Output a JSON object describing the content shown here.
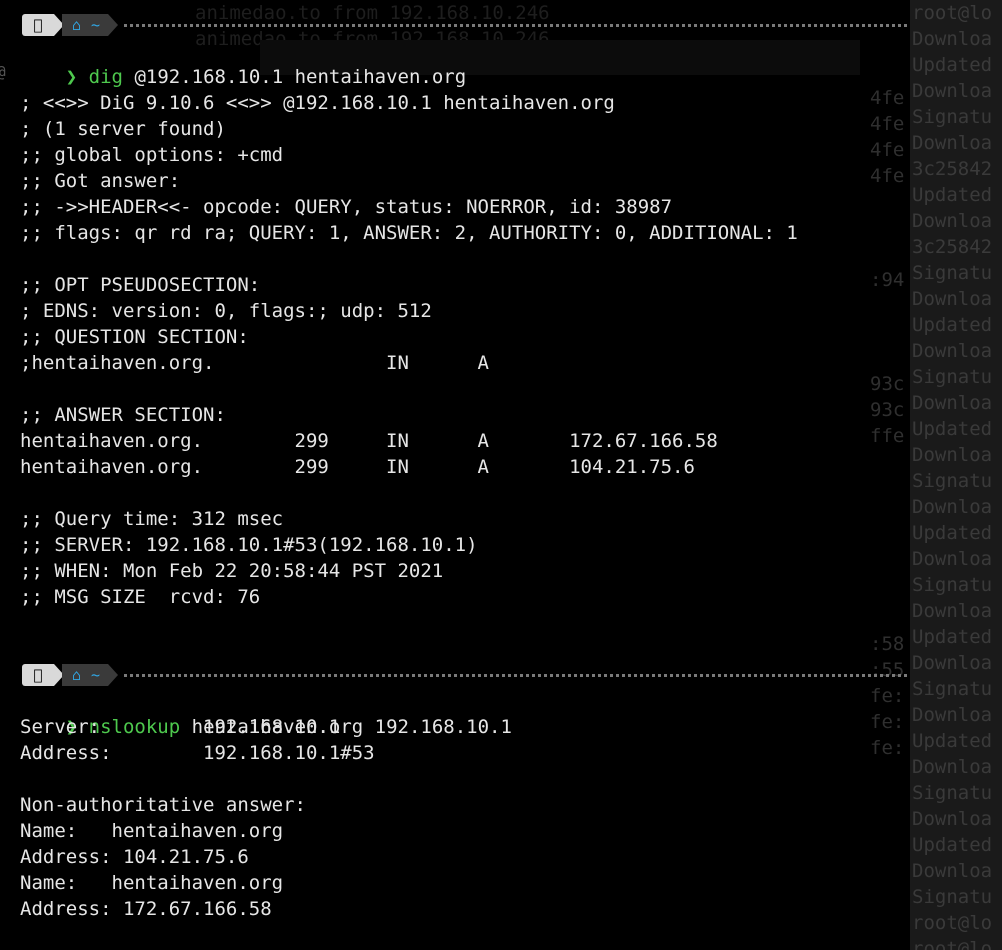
{
  "background": {
    "side_lines": [
      "root@lo",
      "Downloa",
      "Updated",
      "Downloa",
      "Signatu",
      "Downloa",
      "3c25842",
      "Updated",
      "Downloa",
      "3c25842",
      "Signatu",
      "Downloa",
      "Updated",
      "Downloa",
      "Signatu",
      "Downloa",
      "Updated",
      "Downloa",
      "Signatu",
      "Downloa",
      "Updated",
      "Downloa",
      "Signatu",
      "Downloa",
      "Updated",
      "Downloa",
      "Signatu",
      "Downloa",
      "Updated",
      "Downloa",
      "Signatu",
      "Downloa",
      "Updated",
      "Downloa",
      "Signatu",
      "root@lo",
      "root@lo"
    ],
    "mid_lines": [
      "4fe",
      "4fe",
      "4fe",
      "4fe",
      "",
      "",
      "",
      ":94",
      "",
      "",
      "",
      "93c",
      "93c",
      "ffe",
      "",
      "",
      "",
      "",
      "",
      "",
      "",
      ":58",
      ":55",
      "fe:",
      "fe:",
      "fe:"
    ],
    "ghost_lines": [
      "animedao.to from 192.168.10.246",
      "animedao.to from 192.168.10.246"
    ]
  },
  "prompt1": {
    "apple_icon": "apple-icon",
    "home_icon": "home-icon",
    "tilde": "~",
    "chevron": "❯",
    "command": "dig",
    "args": " @192.168.10.1 hentaihaven.org"
  },
  "dig_output": [
    "",
    "; <<>> DiG 9.10.6 <<>> @192.168.10.1 hentaihaven.org",
    "; (1 server found)",
    ";; global options: +cmd",
    ";; Got answer:",
    ";; ->>HEADER<<- opcode: QUERY, status: NOERROR, id: 38987",
    ";; flags: qr rd ra; QUERY: 1, ANSWER: 2, AUTHORITY: 0, ADDITIONAL: 1",
    "",
    ";; OPT PSEUDOSECTION:",
    "; EDNS: version: 0, flags:; udp: 512",
    ";; QUESTION SECTION:",
    ";hentaihaven.org.               IN      A",
    "",
    ";; ANSWER SECTION:",
    "hentaihaven.org.        299     IN      A       172.67.166.58",
    "hentaihaven.org.        299     IN      A       104.21.75.6",
    "",
    ";; Query time: 312 msec",
    ";; SERVER: 192.168.10.1#53(192.168.10.1)",
    ";; WHEN: Mon Feb 22 20:58:44 PST 2021",
    ";; MSG SIZE  rcvd: 76"
  ],
  "prompt2": {
    "apple_icon": "apple-icon",
    "home_icon": "home-icon",
    "tilde": "~",
    "chevron": "❯",
    "command": "nslookup",
    "args": " hentaihaven.org 192.168.10.1"
  },
  "nslookup_output": [
    "Server:         192.168.10.1",
    "Address:        192.168.10.1#53",
    "",
    "Non-authoritative answer:",
    "Name:   hentaihaven.org",
    "Address: 104.21.75.6",
    "Name:   hentaihaven.org",
    "Address: 172.67.166.58"
  ],
  "colors": {
    "command_green": "#4ec94e",
    "home_blue": "#31a8e6",
    "text": "#e6e6e6",
    "background": "#000000"
  }
}
